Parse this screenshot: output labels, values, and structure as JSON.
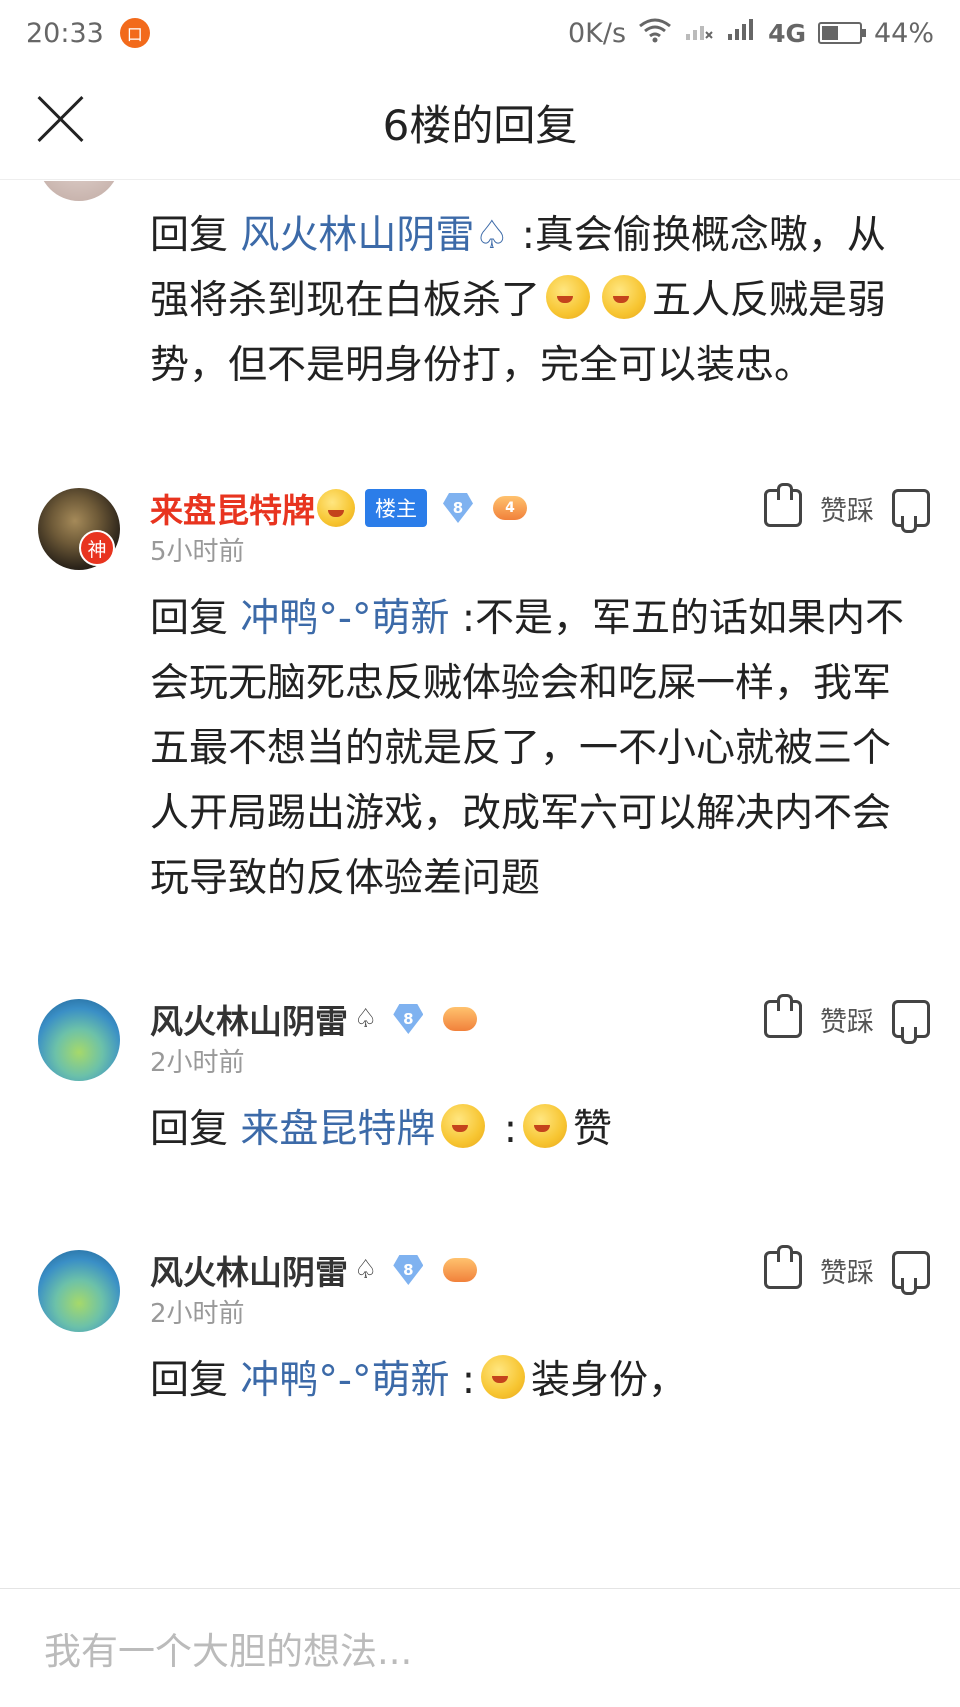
{
  "status_bar": {
    "time": "20:33",
    "app_icon": "口",
    "network_speed": "0K/s",
    "network_type": "4G",
    "battery": "44%",
    "battery_level": 0.44
  },
  "nav": {
    "title": "6楼的回复"
  },
  "replies": [
    {
      "body_prefix": "回复",
      "mention": "风火林山阴雷♤",
      "body_text_1": " :真会偷换概念嗷，从强将杀到现在白板杀了",
      "body_text_2": "五人反贼是弱势，但不是明身份打，完全可以装忠。"
    },
    {
      "username": "来盘昆特牌",
      "floor_tag": "楼主",
      "level": "8",
      "game_level": "4",
      "god_badge": "神",
      "time": "5小时前",
      "like_label": "赞",
      "dislike_label": "踩",
      "body_prefix": "回复",
      "mention": "冲鸭°-°萌新",
      "body_text": " :不是，军五的话如果内不会玩无脑死忠反贼体验会和吃屎一样，我军五最不想当的就是反了，一不小心就被三个人开局踢出游戏，改成军六可以解决内不会玩导致的反体验差问题"
    },
    {
      "username": "风火林山阴雷",
      "spade": "♤",
      "level": "8",
      "time": "2小时前",
      "like_label": "赞",
      "dislike_label": "踩",
      "body_prefix": "回复",
      "mention": "来盘昆特牌",
      "body_text": " :",
      "body_text_2": "赞"
    },
    {
      "username": "风火林山阴雷",
      "spade": "♤",
      "level": "8",
      "time": "2小时前",
      "like_label": "赞",
      "dislike_label": "踩",
      "body_prefix": "回复",
      "mention": "冲鸭°-°萌新",
      "body_text": " :",
      "body_text_2": "装身份，"
    }
  ],
  "comment_input": {
    "placeholder": "我有一个大胆的想法..."
  }
}
